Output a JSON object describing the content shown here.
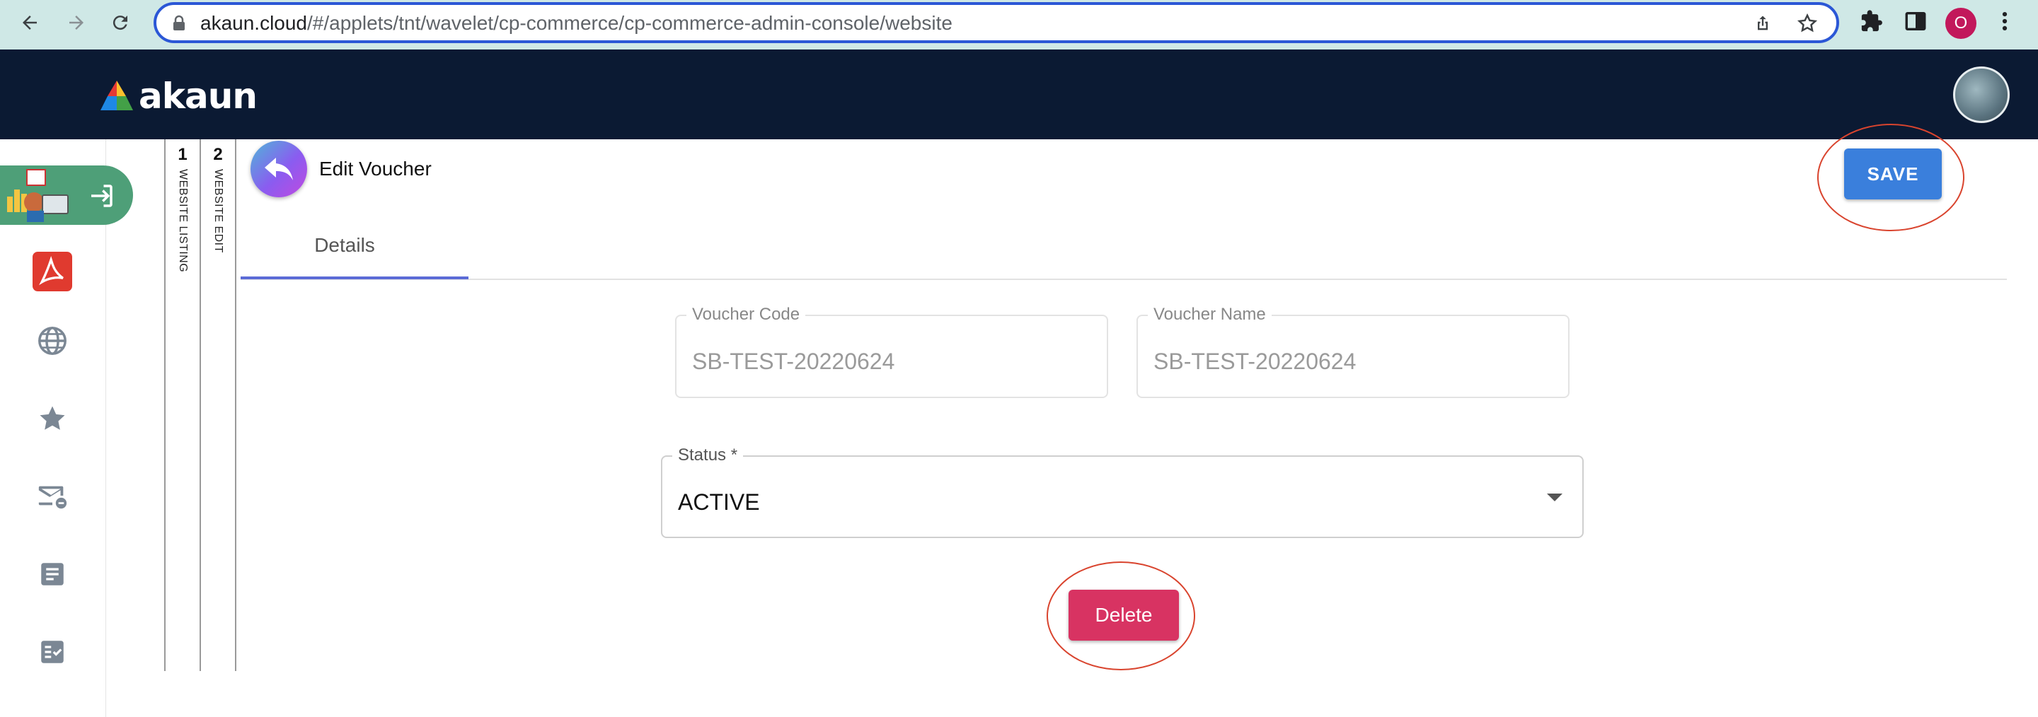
{
  "browser": {
    "url_host": "akaun.cloud",
    "url_path": "/#/applets/tnt/wavelet/cp-commerce/cp-commerce-admin-console/website",
    "profile_initial": "O"
  },
  "header": {
    "logo_text": "akaun"
  },
  "steps": [
    {
      "number": "1",
      "label": "WEBSITE LISTING"
    },
    {
      "number": "2",
      "label": "WEBSITE EDIT"
    }
  ],
  "page": {
    "title": "Edit Voucher",
    "save_label": "SAVE",
    "tab_details": "Details"
  },
  "form": {
    "voucher_code": {
      "label": "Voucher Code",
      "value": "SB-TEST-20220624"
    },
    "voucher_name": {
      "label": "Voucher Name",
      "value": "SB-TEST-20220624"
    },
    "status": {
      "label": "Status *",
      "value": "ACTIVE"
    }
  },
  "delete_label": "Delete",
  "colors": {
    "header_bg": "#0b1a33",
    "save_button": "#3a7fdc",
    "delete_button": "#d83362",
    "active_sidebar": "#4e9f78",
    "annotation_ring": "#d9442e"
  }
}
